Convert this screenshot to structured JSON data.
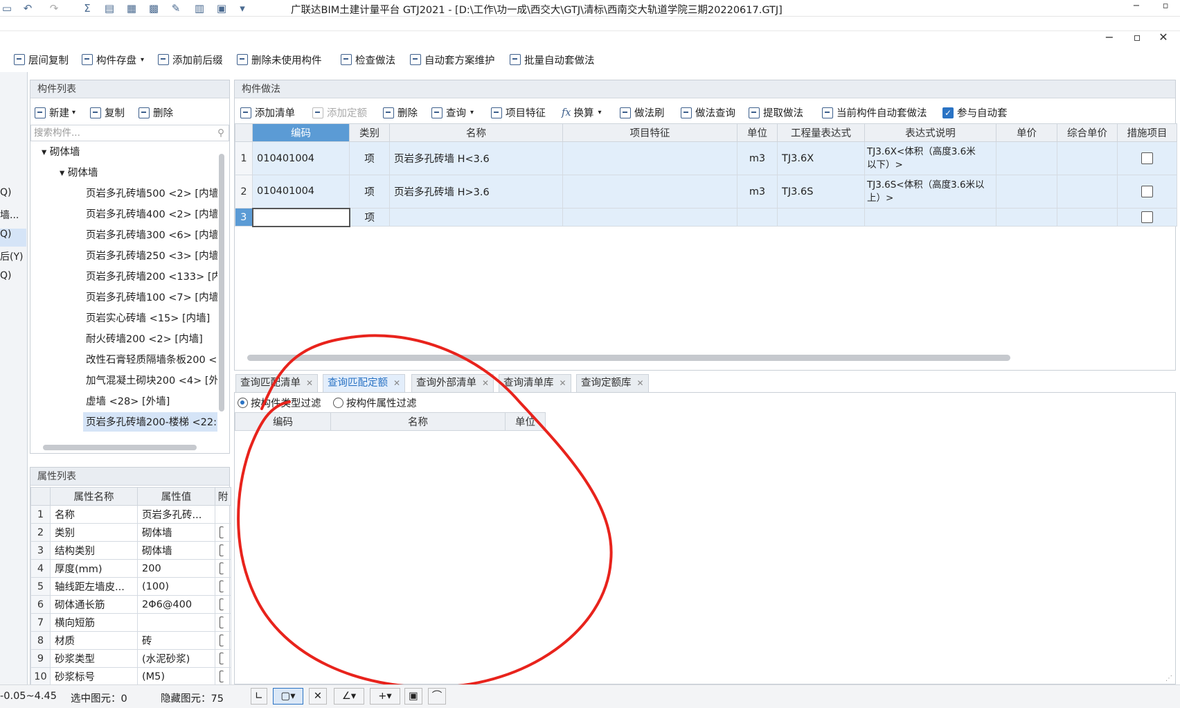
{
  "window": {
    "title": "广联达BIM土建计量平台 GTJ2021 - [D:\\工作\\功一成\\西交大\\GTJ\\清标\\西南交大轨道学院三期20220617.GTJ]",
    "controls": [
      "−",
      "▫",
      "✕"
    ]
  },
  "toolbar": {
    "items": [
      "层间复制",
      "构件存盘",
      "添加前后缀",
      "删除未使用构件",
      "检查做法",
      "自动套方案维护",
      "批量自动套做法"
    ]
  },
  "left_strip": {
    "items": [
      "Q)",
      "墙...",
      "Q)",
      "后(Y)",
      "Q)"
    ]
  },
  "component_list": {
    "title": "构件列表",
    "buttons": {
      "new": "新建",
      "copy": "复制",
      "delete": "删除"
    },
    "search_placeholder": "搜索构件...",
    "tree": {
      "root": "砌体墙",
      "group": "砌体墙",
      "items": [
        "页岩多孔砖墙500 <2> [内墙",
        "页岩多孔砖墙400 <2> [内墙",
        "页岩多孔砖墙300 <6> [内墙",
        "页岩多孔砖墙250 <3> [内墙",
        "页岩多孔砖墙200 <133> [内",
        "页岩多孔砖墙100 <7> [内墙",
        "页岩实心砖墙 <15> [内墙]",
        "耐火砖墙200 <2> [内墙]",
        "改性石膏轻质隔墙条板200 <",
        "加气混凝土砌块200 <4> [外",
        "虚墙 <28> [外墙]",
        "页岩多孔砖墙200-楼梯 <22:"
      ]
    }
  },
  "property_list": {
    "title": "属性列表",
    "headers": [
      "属性名称",
      "属性值",
      "附"
    ],
    "rows": [
      {
        "n": "1",
        "name": "名称",
        "value": "页岩多孔砖..."
      },
      {
        "n": "2",
        "name": "类别",
        "value": "砌体墙"
      },
      {
        "n": "3",
        "name": "结构类别",
        "value": "砌体墙"
      },
      {
        "n": "4",
        "name": "厚度(mm)",
        "value": "200"
      },
      {
        "n": "5",
        "name": "轴线距左墙皮...",
        "value": "(100)"
      },
      {
        "n": "6",
        "name": "砌体通长筋",
        "value": "2Φ6@400"
      },
      {
        "n": "7",
        "name": "横向短筋",
        "value": ""
      },
      {
        "n": "8",
        "name": "材质",
        "value": "砖"
      },
      {
        "n": "9",
        "name": "砂浆类型",
        "value": "(水泥砂浆)"
      },
      {
        "n": "10",
        "name": "砂浆标号",
        "value": "(M5)"
      }
    ]
  },
  "method_panel": {
    "title": "构件做法",
    "buttons": [
      "添加清单",
      "添加定额",
      "删除",
      "查询",
      "项目特征",
      "换算",
      "做法刷",
      "做法查询",
      "提取做法",
      "当前构件自动套做法"
    ],
    "auto_check": "参与自动套",
    "headers": [
      "编码",
      "类别",
      "名称",
      "项目特征",
      "单位",
      "工程量表达式",
      "表达式说明",
      "单价",
      "综合单价",
      "措施项目"
    ],
    "rows": [
      {
        "n": "1",
        "code": "010401004",
        "type": "项",
        "name": "页岩多孔砖墙 H<3.6",
        "feature": "",
        "unit": "m3",
        "expr": "TJ3.6X",
        "desc1": "TJ3.6X<体积（高度3.6米",
        "desc2": "以下）>"
      },
      {
        "n": "2",
        "code": "010401004",
        "type": "项",
        "name": "页岩多孔砖墙 H>3.6",
        "feature": "",
        "unit": "m3",
        "expr": "TJ3.6S",
        "desc1": "TJ3.6S<体积（高度3.6米以",
        "desc2": "上）>"
      },
      {
        "n": "3",
        "code": "",
        "type": "项",
        "name": "",
        "feature": "",
        "unit": "",
        "expr": "",
        "desc1": "",
        "desc2": ""
      }
    ]
  },
  "query_tabs": {
    "tabs": [
      "查询匹配清单",
      "查询匹配定额",
      "查询外部清单",
      "查询清单库",
      "查询定额库"
    ],
    "filter1": "按构件类型过滤",
    "filter2": "按构件属性过滤",
    "headers": [
      "编码",
      "名称",
      "单位"
    ]
  },
  "status": {
    "range": "-0.05~4.45",
    "selected": "选中图元：0",
    "hidden": "隐藏图元：75"
  }
}
